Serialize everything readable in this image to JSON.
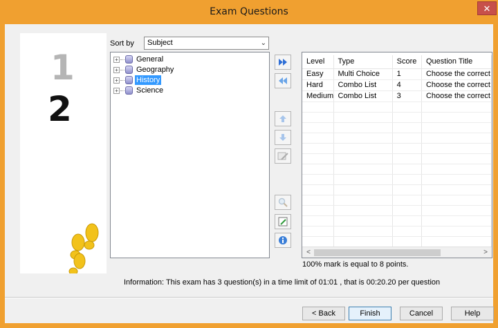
{
  "window": {
    "title": "Exam Questions",
    "close_glyph": "✕"
  },
  "side_panel": {
    "step_previous": "1",
    "step_current": "2",
    "icon": "footprints-icon"
  },
  "sort": {
    "label": "Sort by",
    "selected": "Subject"
  },
  "tree": {
    "items": [
      {
        "label": "General",
        "selected": false
      },
      {
        "label": "Geography",
        "selected": false
      },
      {
        "label": "History",
        "selected": true
      },
      {
        "label": "Science",
        "selected": false
      }
    ]
  },
  "toolbar": {
    "buttons": [
      "add-all-icon",
      "remove-all-icon",
      "move-up-icon",
      "move-down-icon",
      "edit-question-icon",
      "search-icon",
      "edit-note-icon",
      "info-icon"
    ]
  },
  "grid": {
    "columns": [
      "Level",
      "Type",
      "Score",
      "Question Title"
    ],
    "rows": [
      [
        "Easy",
        "Multi Choice",
        "1",
        "Choose the correct ag"
      ],
      [
        "Hard",
        "Combo List",
        "4",
        "Choose the correct da"
      ],
      [
        "Medium",
        "Combo List",
        "3",
        "Choose the correct ye"
      ]
    ]
  },
  "mark_text": "100% mark is equal to 8 points.",
  "info_text": "Information: This exam has 3 question(s) in a time limit of 01:01 , that is 00:20.20 per question",
  "buttons": {
    "back": "< Back",
    "finish": "Finish",
    "cancel": "Cancel",
    "help": "Help"
  },
  "colors": {
    "title_bar": "#f0a030",
    "close": "#c7504a",
    "selection": "#3399ff",
    "toolbar_blue": "#2f6fd6",
    "footprints": "#f2c21b"
  }
}
